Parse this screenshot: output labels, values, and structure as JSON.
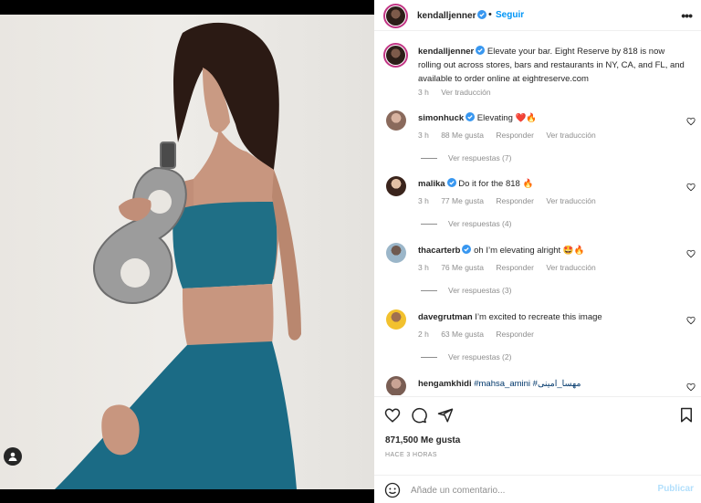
{
  "post": {
    "author": "kendalljenner",
    "follow_label": "Seguir",
    "dot": "•",
    "more_label": "•••"
  },
  "caption": {
    "username": "kendalljenner",
    "text": "Elevate your bar. Eight Reserve by 818 is now rolling out across stores, bars and restaurants in NY, CA, and FL, and available to order online at eightreserve.com",
    "time": "3 h",
    "translate": "Ver traducción"
  },
  "comments": [
    {
      "username": "simonhuck",
      "verified": true,
      "text": "Elevating ❤️🔥",
      "time": "3 h",
      "likes": "88 Me gusta",
      "reply": "Responder",
      "translate": "Ver traducción",
      "replies": "Ver respuestas (7)"
    },
    {
      "username": "malika",
      "verified": true,
      "text": "Do it for the 818 🔥",
      "time": "3 h",
      "likes": "77 Me gusta",
      "reply": "Responder",
      "translate": "Ver traducción",
      "replies": "Ver respuestas (4)"
    },
    {
      "username": "thacarterb",
      "verified": true,
      "text": "oh I’m elevating alright 🤩🔥",
      "time": "3 h",
      "likes": "76 Me gusta",
      "reply": "Responder",
      "translate": "Ver traducción",
      "replies": "Ver respuestas (3)"
    },
    {
      "username": "davegrutman",
      "verified": true,
      "text": "I’m excited to recreate this image",
      "time": "2 h",
      "likes": "63 Me gusta",
      "reply": "Responder",
      "translate": "",
      "replies": "Ver respuestas (2)"
    },
    {
      "username": "hengamkhidi",
      "verified": false,
      "text": "#mahsa_amini #مهسا_امینی",
      "time": "",
      "likes": "",
      "reply": "",
      "translate": "",
      "replies": ""
    }
  ],
  "stats": {
    "likes": "871,500 Me gusta",
    "time_ago": "HACE 3 HORAS"
  },
  "composer": {
    "placeholder": "Añade un comentario...",
    "publish_label": "Publicar"
  },
  "icons": {
    "like": "heart-outline-icon",
    "comment": "comment-bubble-icon",
    "share": "paper-plane-icon",
    "save": "bookmark-icon",
    "emoji": "smiley-icon",
    "tag": "user-tag-icon",
    "verified": "verified-badge-icon"
  },
  "colors": {
    "link_blue": "#0095f6",
    "publish_disabled": "#b2dffc",
    "verified_blue": "#3897f0",
    "text_muted": "#8e8e8e"
  }
}
